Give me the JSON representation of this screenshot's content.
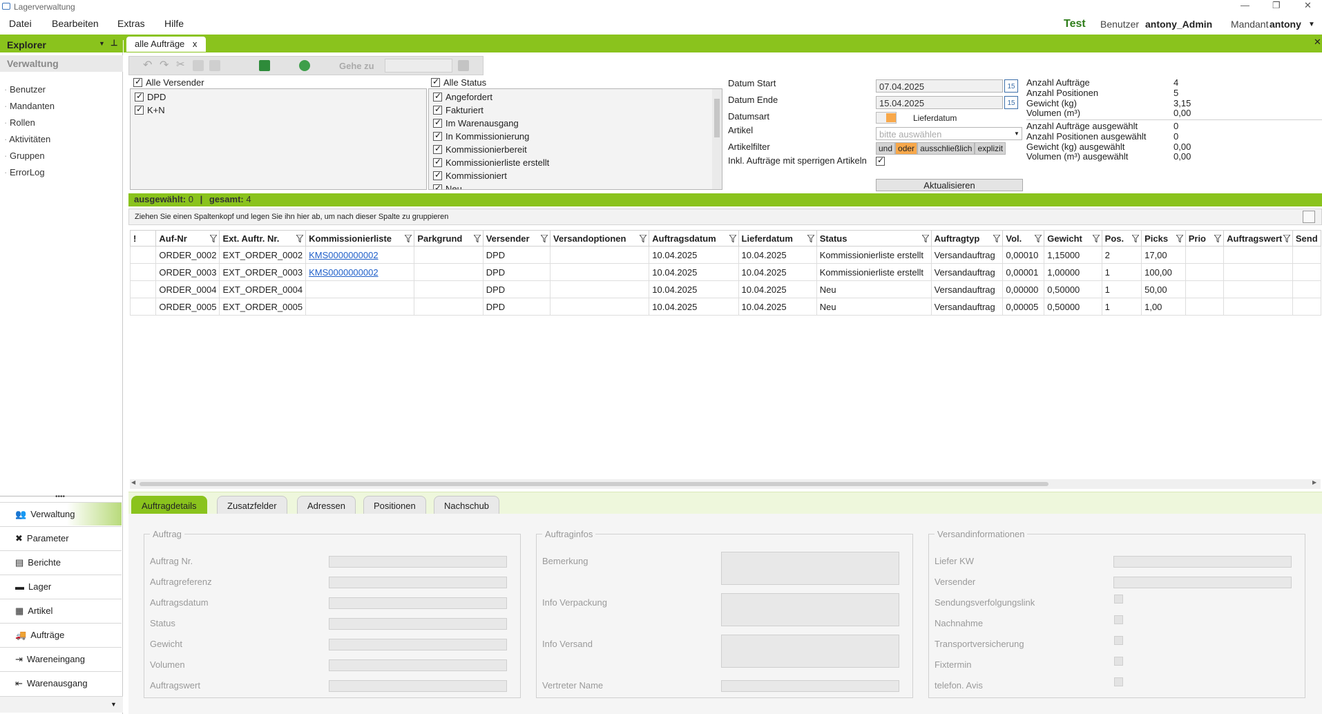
{
  "window": {
    "title": "Lagerverwaltung",
    "min": "—",
    "restore": "❐",
    "close": "✕"
  },
  "menu": [
    "Datei",
    "Bearbeiten",
    "Extras",
    "Hilfe"
  ],
  "header": {
    "env": "Test",
    "user_label": "Benutzer",
    "user": "antony_Admin",
    "mandant_label": "Mandant",
    "mandant": "antony"
  },
  "sidebar": {
    "title": "Explorer",
    "section": "Verwaltung",
    "links": [
      "Benutzer",
      "Mandanten",
      "Rollen",
      "Aktivitäten",
      "Gruppen",
      "ErrorLog"
    ],
    "nav": [
      "Verwaltung",
      "Parameter",
      "Berichte",
      "Lager",
      "Artikel",
      "Aufträge",
      "Wareneingang",
      "Warenausgang"
    ]
  },
  "tab": {
    "label": "alle Aufträge",
    "close": "x"
  },
  "toolbar": {
    "goto_label": "Gehe zu"
  },
  "filters": {
    "versender_all": "Alle Versender",
    "versender": [
      "DPD",
      "K+N"
    ],
    "status_all": "Alle Status",
    "status": [
      "Angefordert",
      "Fakturiert",
      "Im Warenausgang",
      "In Kommissionierung",
      "Kommissionierbereit",
      "Kommissionierliste erstellt",
      "Kommissioniert",
      "Neu"
    ],
    "datum_start_label": "Datum Start",
    "datum_start": "07.04.2025",
    "datum_ende_label": "Datum Ende",
    "datum_ende": "15.04.2025",
    "datumsart_label": "Datumsart",
    "datumsart": "Lieferdatum",
    "artikel_label": "Artikel",
    "artikel_placeholder": "bitte auswählen",
    "artikelfilter_label": "Artikelfilter",
    "artikelfilter_options": [
      "und",
      "oder",
      "ausschließlich",
      "explizit"
    ],
    "sperrig_label": "Inkl. Aufträge mit sperrigen Artikeln",
    "refresh": "Aktualisieren",
    "cal_icon_text": "15"
  },
  "stats": [
    {
      "label": "Anzahl Aufträge",
      "value": "4"
    },
    {
      "label": "Anzahl Positionen",
      "value": "5"
    },
    {
      "label": "Gewicht (kg)",
      "value": "3,15"
    },
    {
      "label": "Volumen (m³)",
      "value": "0,00"
    },
    {
      "label": "Anzahl Aufträge ausgewählt",
      "value": "0"
    },
    {
      "label": "Anzahl Positionen ausgewählt",
      "value": "0"
    },
    {
      "label": "Gewicht (kg) ausgewählt",
      "value": "0,00"
    },
    {
      "label": "Volumen (m³) ausgewählt",
      "value": "0,00"
    }
  ],
  "selection": {
    "selected_label": "ausgewählt:",
    "selected": "0",
    "sep": "|",
    "total_label": "gesamt:",
    "total": "4"
  },
  "grid": {
    "group_hint": "Ziehen Sie einen Spaltenkopf und legen Sie ihn hier ab, um nach dieser Spalte zu gruppieren",
    "columns": [
      "!",
      "Auf-Nr",
      "Ext. Auftr. Nr.",
      "Kommissionierliste",
      "Parkgrund",
      "Versender",
      "Versandoptionen",
      "Auftragsdatum",
      "Lieferdatum",
      "Status",
      "Auftragtyp",
      "Vol.",
      "Gewicht",
      "Pos.",
      "Picks",
      "Prio",
      "Auftragswert",
      "Send"
    ],
    "rows": [
      [
        "",
        "ORDER_0002",
        "EXT_ORDER_0002",
        "KMS0000000002",
        "",
        "DPD",
        "",
        "10.04.2025",
        "10.04.2025",
        "Kommissionierliste erstellt",
        "Versandauftrag",
        "0,00010",
        "1,15000",
        "2",
        "17,00",
        "",
        "",
        ""
      ],
      [
        "",
        "ORDER_0003",
        "EXT_ORDER_0003",
        "KMS0000000002",
        "",
        "DPD",
        "",
        "10.04.2025",
        "10.04.2025",
        "Kommissionierliste erstellt",
        "Versandauftrag",
        "0,00001",
        "1,00000",
        "1",
        "100,00",
        "",
        "",
        ""
      ],
      [
        "",
        "ORDER_0004",
        "EXT_ORDER_0004",
        "",
        "",
        "DPD",
        "",
        "10.04.2025",
        "10.04.2025",
        "Neu",
        "Versandauftrag",
        "0,00000",
        "0,50000",
        "1",
        "50,00",
        "",
        "",
        ""
      ],
      [
        "",
        "ORDER_0005",
        "EXT_ORDER_0005",
        "",
        "",
        "DPD",
        "",
        "10.04.2025",
        "10.04.2025",
        "Neu",
        "Versandauftrag",
        "0,00005",
        "0,50000",
        "1",
        "1,00",
        "",
        "",
        ""
      ]
    ]
  },
  "bottom_tabs": [
    "Auftragdetails",
    "Zusatzfelder",
    "Adressen",
    "Positionen",
    "Nachschub"
  ],
  "details": {
    "auftrag": {
      "title": "Auftrag",
      "fields": [
        "Auftrag Nr.",
        "Auftragreferenz",
        "Auftragsdatum",
        "Status",
        "Gewicht",
        "Volumen",
        "Auftragswert"
      ]
    },
    "auftraginfos": {
      "title": "Auftraginfos",
      "fields": [
        "Bemerkung",
        "Info Verpackung",
        "Info Versand",
        "Vertreter Name"
      ]
    },
    "versand": {
      "title": "Versandinformationen",
      "fields": [
        "Liefer KW",
        "Versender",
        "Sendungsverfolgungslink",
        "Nachnahme",
        "Transportversicherung",
        "Fixtermin",
        "telefon. Avis"
      ]
    }
  },
  "colors": {
    "accent": "#8ac31d",
    "link": "#1f5fc9",
    "highlight": "#f8a84a"
  }
}
